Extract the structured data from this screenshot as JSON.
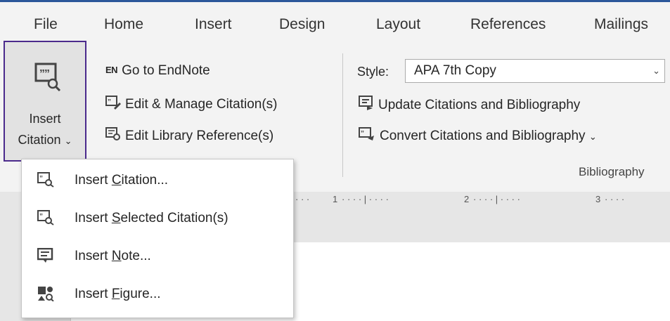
{
  "tabs": [
    "File",
    "Home",
    "Insert",
    "Design",
    "Layout",
    "References",
    "Mailings"
  ],
  "insert_citation": {
    "line1": "Insert",
    "line2": "Citation",
    "chevron": "⌄"
  },
  "endnote": {
    "en_badge": "EN",
    "goto": "Go to EndNote",
    "edit_manage": "Edit & Manage Citation(s)",
    "edit_library": "Edit Library Reference(s)"
  },
  "bibliography": {
    "style_label": "Style:",
    "style_value": "APA 7th Copy",
    "update": "Update Citations and Bibliography",
    "convert": "Convert Citations and Bibliography",
    "convert_chevron": "⌄",
    "group_label": "Bibliography"
  },
  "ruler_ticks": [
    "1",
    "2",
    "3"
  ],
  "menu": {
    "items": [
      {
        "pre": "Insert ",
        "key": "C",
        "post": "itation...",
        "icon": "insert-citation-icon"
      },
      {
        "pre": "Insert ",
        "key": "S",
        "post": "elected Citation(s)",
        "icon": "insert-selected-citation-icon"
      },
      {
        "pre": "Insert ",
        "key": "N",
        "post": "ote...",
        "icon": "insert-note-icon"
      },
      {
        "pre": "Insert ",
        "key": "F",
        "post": "igure...",
        "icon": "insert-figure-icon"
      }
    ]
  },
  "colors": {
    "accent": "#2b579a",
    "highlight_border": "#4b2a8c",
    "ribbon_bg": "#f3f3f3"
  }
}
